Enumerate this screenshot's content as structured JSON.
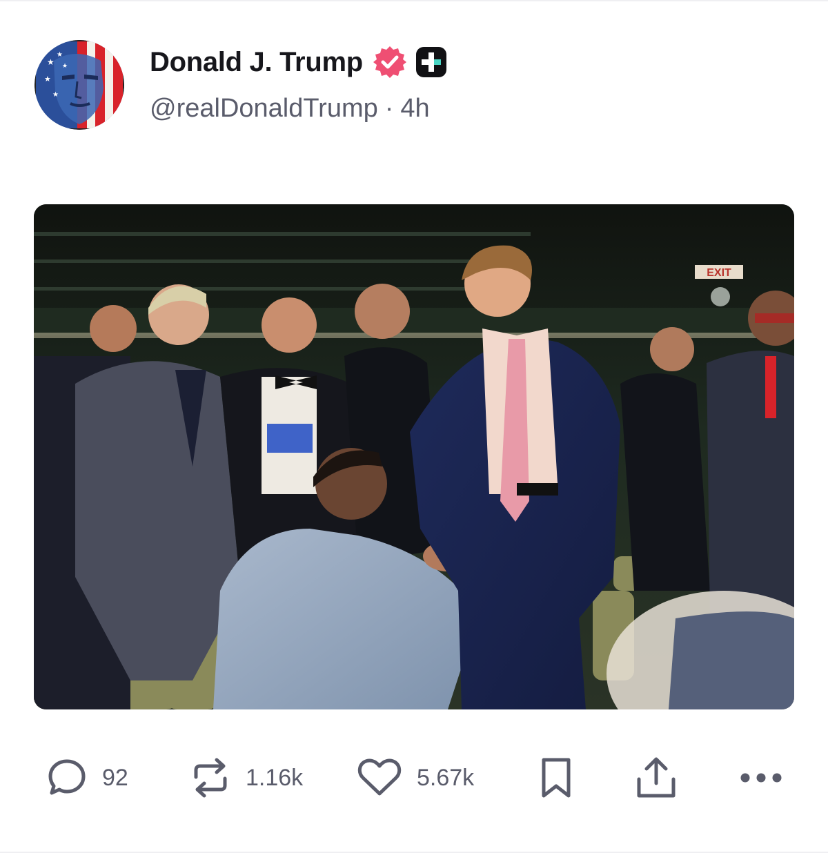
{
  "post": {
    "author": {
      "display_name": "Donald J. Trump",
      "handle": "@realDonaldTrump",
      "separator": "·",
      "time_ago": "4h",
      "verified_icon": "verified-badge-icon",
      "plus_icon": "plus-badge-icon"
    },
    "media": {
      "type": "photo",
      "exit_sign_text": "EXIT"
    },
    "actions": {
      "reply": {
        "icon": "reply-icon",
        "count": "92"
      },
      "repost": {
        "icon": "repost-icon",
        "count": "1.16k"
      },
      "like": {
        "icon": "heart-icon",
        "count": "5.67k"
      },
      "bookmark": {
        "icon": "bookmark-icon"
      },
      "share": {
        "icon": "share-icon"
      },
      "more": {
        "icon": "more-icon"
      }
    }
  },
  "colors": {
    "name": "#17171c",
    "meta": "#5a5c6b",
    "verified": "#ef4f73",
    "icon": "#5a5c6b",
    "divider": "#efeff2"
  }
}
